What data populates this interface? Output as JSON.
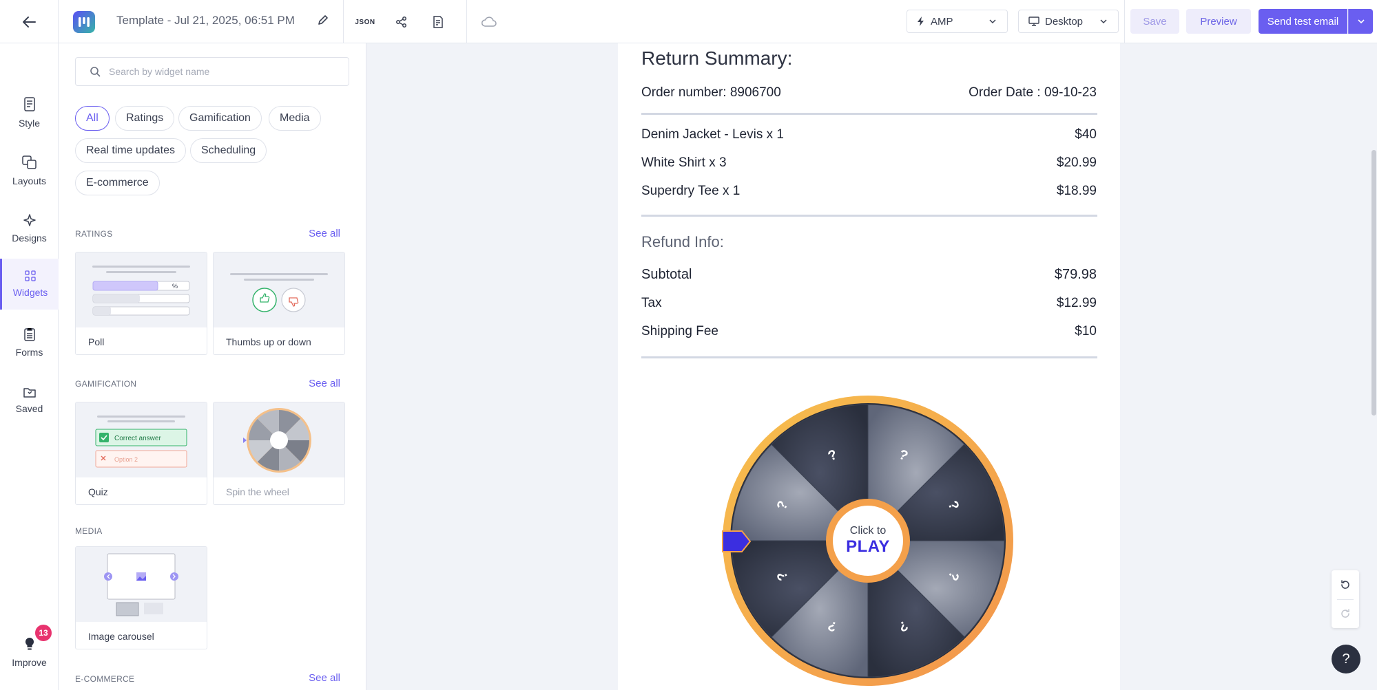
{
  "header": {
    "template_title": "Template - Jul 21, 2025, 06:51 PM",
    "json_label": "JSON",
    "format_select": "AMP",
    "device_select": "Desktop",
    "save_label": "Save",
    "preview_label": "Preview",
    "send_label": "Send test email"
  },
  "rail": {
    "items": [
      {
        "label": "Style",
        "icon": "document-icon"
      },
      {
        "label": "Layouts",
        "icon": "layouts-icon"
      },
      {
        "label": "Designs",
        "icon": "sparkle-icon"
      },
      {
        "label": "Widgets",
        "icon": "widgets-icon"
      },
      {
        "label": "Forms",
        "icon": "form-icon"
      },
      {
        "label": "Saved",
        "icon": "saved-icon"
      }
    ],
    "active": "Widgets",
    "improve_label": "Improve",
    "improve_badge": "13"
  },
  "panel": {
    "search_placeholder": "Search by widget name",
    "filters": [
      "All",
      "Ratings",
      "Gamification",
      "Media",
      "Real time updates",
      "Scheduling",
      "E-commerce"
    ],
    "active_filter": "All",
    "see_all": "See all",
    "sections": {
      "ratings": {
        "title": "RATINGS",
        "cards": [
          "Poll",
          "Thumbs up or down"
        ]
      },
      "gamification": {
        "title": "GAMIFICATION",
        "cards": [
          "Quiz",
          "Spin the wheel"
        ]
      },
      "media": {
        "title": "MEDIA",
        "cards": [
          "Image carousel"
        ]
      },
      "ecommerce": {
        "title": "E-COMMERCE"
      }
    },
    "thumb_text": {
      "poll_percent": "%",
      "quiz_correct": "Correct answer",
      "quiz_option": "Option 2"
    }
  },
  "email": {
    "summary_title": "Return Summary:",
    "order_number": "Order number: 8906700",
    "order_date": "Order Date : 09-10-23",
    "items": [
      {
        "name": "Denim Jacket - Levis x 1",
        "price": "$40"
      },
      {
        "name": "White Shirt x 3",
        "price": "$20.99"
      },
      {
        "name": "Superdry Tee x 1",
        "price": "$18.99"
      }
    ],
    "refund_title": "Refund Info:",
    "refund": [
      {
        "name": "Subtotal",
        "price": "$79.98"
      },
      {
        "name": "Tax",
        "price": "$12.99"
      },
      {
        "name": "Shipping Fee",
        "price": "$10"
      }
    ],
    "wheel": {
      "button_line1": "Click to",
      "button_line2": "PLAY",
      "segment_label": "?",
      "segments": 8,
      "ring_color": "#f4a04a",
      "pointer_color": "#3b2ee0"
    }
  },
  "colors": {
    "accent": "#6a5ef0",
    "badge": "#e8336e"
  }
}
